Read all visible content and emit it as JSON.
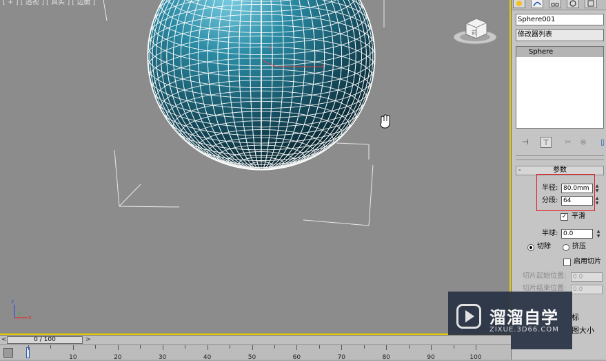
{
  "viewport": {
    "label": "[ + ] [ 透视 ] [ 真实 ] [ 边面 ]",
    "object_name": "Sphere001",
    "cursor_icon": "hand-pan-cursor",
    "gizmo_icon": "viewcube-icon",
    "axis_icon": "xyz-axis-tripod-icon"
  },
  "command_panel": {
    "tabs": [
      "create-icon",
      "modify-icon",
      "hierarchy-icon",
      "motion-icon",
      "display-icon"
    ],
    "object_name": "Sphere001",
    "modifier_list": "修改器列表",
    "modifier_stack": [
      "Sphere"
    ],
    "stack_tools": [
      "pin-stack-icon",
      "show-end-result-icon",
      "make-unique-icon",
      "remove-modifier-icon",
      "configure-sets-icon"
    ],
    "rollout_title": "参数",
    "rollout_toggle": "-",
    "radius_label": "半径:",
    "radius_value": "80.0mm",
    "segments_label": "分段:",
    "segments_value": "64",
    "smooth_label": "平滑",
    "smooth_checked": true,
    "hemisphere_label": "半球:",
    "hemisphere_value": "0.0",
    "chop_label": "切除",
    "squash_label": "挤压",
    "squash_selected": false,
    "chop_selected": true,
    "slice_on_label": "启用切片",
    "slice_from_label": "切片起始位置:",
    "slice_from_value": "0.0",
    "slice_to_label": "切片结束位置:",
    "slice_to_value": "0.0",
    "map_coords_tail": "标",
    "real_world_tail": "图大小"
  },
  "watermark": {
    "title": "溜溜自学",
    "url": "ZIXUE.3D66.COM"
  },
  "timeline": {
    "slider_text": "0 / 100",
    "prev_arrow": "<",
    "next_arrow": ">",
    "ticks": [
      "10",
      "20",
      "30",
      "40",
      "50",
      "60",
      "70",
      "80",
      "90",
      "100"
    ]
  },
  "colors": {
    "viewport_bg": "#8c8c8c",
    "sphere": "#2a7f97",
    "wire": "#ffffff",
    "selection_box": "#e02020",
    "active_border": "#e6c800"
  }
}
